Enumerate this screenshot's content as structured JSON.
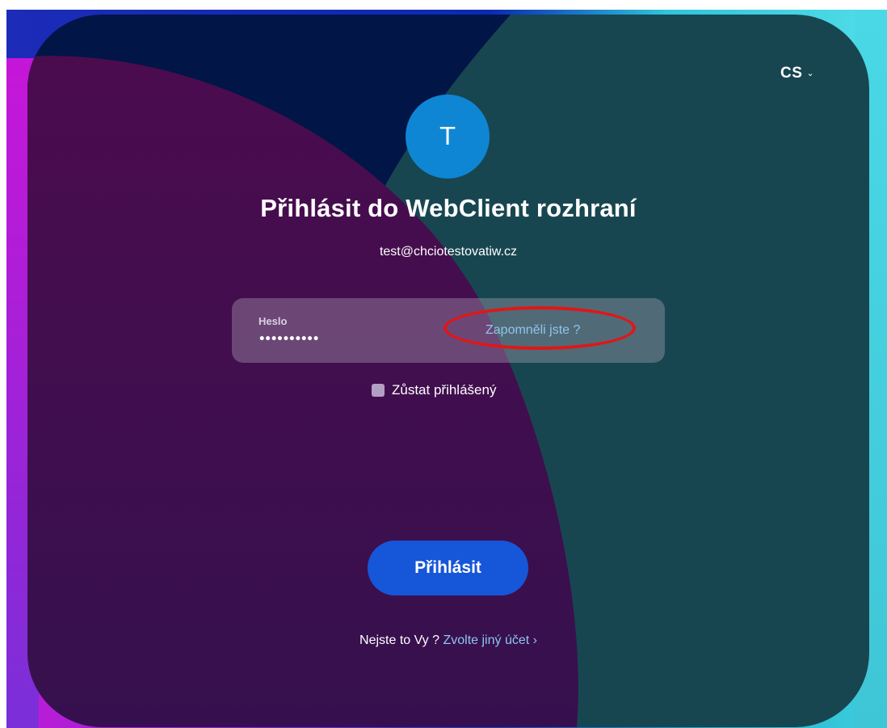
{
  "language": {
    "current": "CS",
    "chevron": "⌄"
  },
  "avatar": {
    "initial": "T"
  },
  "login": {
    "title": "Přihlásit do WebClient rozhraní",
    "email": "test@chciotestovatiw.cz",
    "password_label": "Heslo",
    "password_value": "••••••••••",
    "forgot_link": "Zapomněli jste ?",
    "remember_label": "Zůstat přihlášený",
    "submit_label": "Přihlásit",
    "not_you_text": "Nejste to Vy ?",
    "other_account_link": "Zvolte jiný účet ›"
  },
  "colors": {
    "card_teal": "#184650",
    "card_navy": "#021547",
    "card_purple": "#3c0f4f",
    "avatar_blue": "#0e86d4",
    "button_blue": "#1656d8",
    "link_blue": "#8ec6ee",
    "annotation_red": "#e01717"
  }
}
